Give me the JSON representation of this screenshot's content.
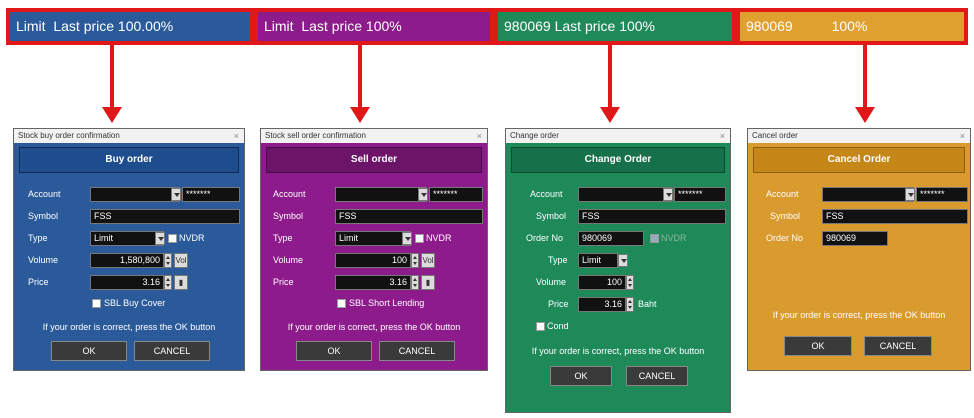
{
  "bars": [
    {
      "text": "Limit  Last price 100.00%",
      "color": "#2a5a9a"
    },
    {
      "text": "Limit  Last price 100%",
      "color": "#8e1b8b"
    },
    {
      "text": "980069 Last price 100%",
      "color": "#1e8a5a"
    },
    {
      "text": "980069          100%",
      "color": "#e0a030"
    }
  ],
  "common": {
    "account_label": "Account",
    "symbol_label": "Symbol",
    "type_label": "Type",
    "volume_label": "Volume",
    "price_label": "Price",
    "order_no_label": "Order No",
    "password": "*******",
    "symbol": "FSS",
    "type_value": "Limit",
    "nvdr": "NVDR",
    "vol_btn": "Vol",
    "ok": "OK",
    "cancel": "CANCEL",
    "message": "If your order is correct, press the OK button",
    "close": "×"
  },
  "buy": {
    "window_title": "Stock buy order confirmation",
    "header": "Buy order",
    "volume": "1,580,800",
    "price": "3.16",
    "sbl": "SBL Buy Cover",
    "header_bg": "#1d4d8c",
    "body_bg": "#2a5a9a"
  },
  "sell": {
    "window_title": "Stock sell order confirmation",
    "header": "Sell order",
    "volume": "100",
    "price": "3.16",
    "sbl": "SBL Short Lending",
    "header_bg": "#6b1468",
    "body_bg": "#8e1b8b"
  },
  "change": {
    "window_title": "Change order",
    "header": "Change Order",
    "order_no": "980069",
    "volume": "100",
    "price": "3.16",
    "baht": "Baht",
    "cond": "Cond",
    "header_bg": "#16704a",
    "body_bg": "#1e8a5a"
  },
  "cancel": {
    "window_title": "Cancel order",
    "header": "Cancel Order",
    "order_no": "980069",
    "header_bg": "#c58718",
    "body_bg": "#d99a2e"
  }
}
